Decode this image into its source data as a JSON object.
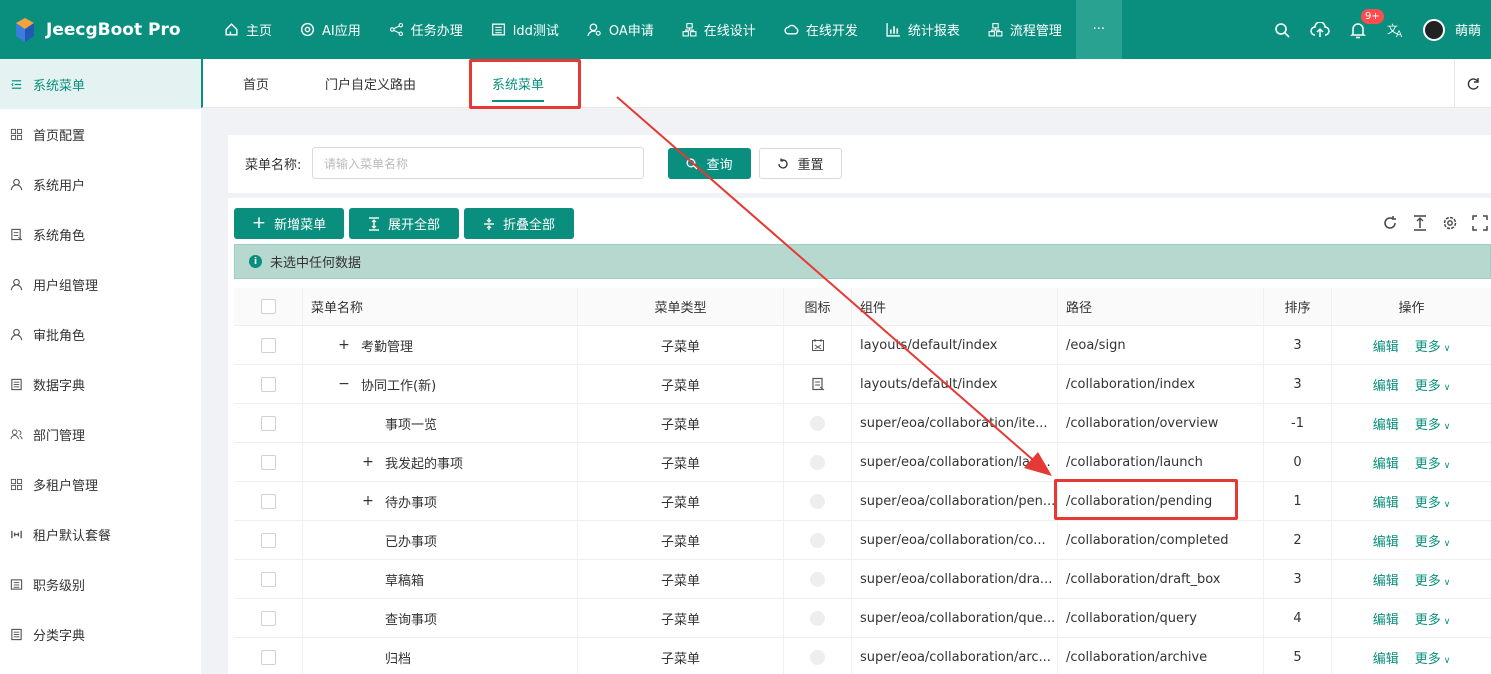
{
  "app": {
    "title": "JeecgBoot Pro",
    "brand_color": "#0a8f7e"
  },
  "topnav": {
    "items": [
      {
        "label": "主页",
        "icon": "home-icon"
      },
      {
        "label": "AI应用",
        "icon": "ai-icon"
      },
      {
        "label": "任务办理",
        "icon": "share-icon"
      },
      {
        "label": "ldd测试",
        "icon": "list-icon"
      },
      {
        "label": "OA申请",
        "icon": "user-search-icon"
      },
      {
        "label": "在线设计",
        "icon": "cluster-icon"
      },
      {
        "label": "在线开发",
        "icon": "cloud-icon"
      },
      {
        "label": "统计报表",
        "icon": "bar-chart-icon"
      },
      {
        "label": "流程管理",
        "icon": "cluster-icon"
      }
    ],
    "more_label": "···"
  },
  "header_right": {
    "badge": "9+",
    "username": "萌萌"
  },
  "sidebar": {
    "items": [
      {
        "label": "系统菜单",
        "icon": "menu-icon"
      },
      {
        "label": "首页配置",
        "icon": "grid-icon"
      },
      {
        "label": "系统用户",
        "icon": "user-icon"
      },
      {
        "label": "系统角色",
        "icon": "role-icon"
      },
      {
        "label": "用户组管理",
        "icon": "user-icon"
      },
      {
        "label": "审批角色",
        "icon": "user-icon"
      },
      {
        "label": "数据字典",
        "icon": "book-icon"
      },
      {
        "label": "部门管理",
        "icon": "team-icon"
      },
      {
        "label": "多租户管理",
        "icon": "grid-icon"
      },
      {
        "label": "租户默认套餐",
        "icon": "package-icon"
      },
      {
        "label": "职务级别",
        "icon": "list-icon"
      },
      {
        "label": "分类字典",
        "icon": "book-icon"
      }
    ]
  },
  "tabs": [
    {
      "label": "首页"
    },
    {
      "label": "门户自定义路由"
    },
    {
      "label": "系统菜单"
    }
  ],
  "search": {
    "label": "菜单名称:",
    "placeholder": "请输入菜单名称",
    "query_button": "查询",
    "reset_button": "重置"
  },
  "toolbar": {
    "add_button": "新增菜单",
    "expand_button": "展开全部",
    "collapse_button": "折叠全部"
  },
  "alert": {
    "text": "未选中任何数据"
  },
  "table": {
    "headers": {
      "name": "菜单名称",
      "type": "菜单类型",
      "icon": "图标",
      "component": "组件",
      "path": "路径",
      "sort": "排序",
      "op": "操作"
    },
    "edit_label": "编辑",
    "more_label": "更多",
    "rows": [
      {
        "name": "考勤管理",
        "expander": "+",
        "indent": 1,
        "type": "子菜单",
        "component": "layouts/default/index",
        "path": "/eoa/sign",
        "sort": "3"
      },
      {
        "name": "协同工作(新)",
        "expander": "−",
        "indent": 1,
        "type": "子菜单",
        "component": "layouts/default/index",
        "path": "/collaboration/index",
        "sort": "3"
      },
      {
        "name": "事项一览",
        "expander": "",
        "indent": 2,
        "type": "子菜单",
        "component": "super/eoa/collaboration/ite...",
        "path": "/collaboration/overview",
        "sort": "-1"
      },
      {
        "name": "我发起的事项",
        "expander": "+",
        "indent": 2,
        "type": "子菜单",
        "component": "super/eoa/collaboration/lau...",
        "path": "/collaboration/launch",
        "sort": "0"
      },
      {
        "name": "待办事项",
        "expander": "+",
        "indent": 2,
        "type": "子菜单",
        "component": "super/eoa/collaboration/pen...",
        "path": "/collaboration/pending",
        "sort": "1"
      },
      {
        "name": "已办事项",
        "expander": "",
        "indent": 2,
        "type": "子菜单",
        "component": "super/eoa/collaboration/co...",
        "path": "/collaboration/completed",
        "sort": "2"
      },
      {
        "name": "草稿箱",
        "expander": "",
        "indent": 2,
        "type": "子菜单",
        "component": "super/eoa/collaboration/dra...",
        "path": "/collaboration/draft_box",
        "sort": "3"
      },
      {
        "name": "查询事项",
        "expander": "",
        "indent": 2,
        "type": "子菜单",
        "component": "super/eoa/collaboration/que...",
        "path": "/collaboration/query",
        "sort": "4"
      },
      {
        "name": "归档",
        "expander": "",
        "indent": 2,
        "type": "子菜单",
        "component": "super/eoa/collaboration/arc...",
        "path": "/collaboration/archive",
        "sort": "5"
      }
    ]
  }
}
